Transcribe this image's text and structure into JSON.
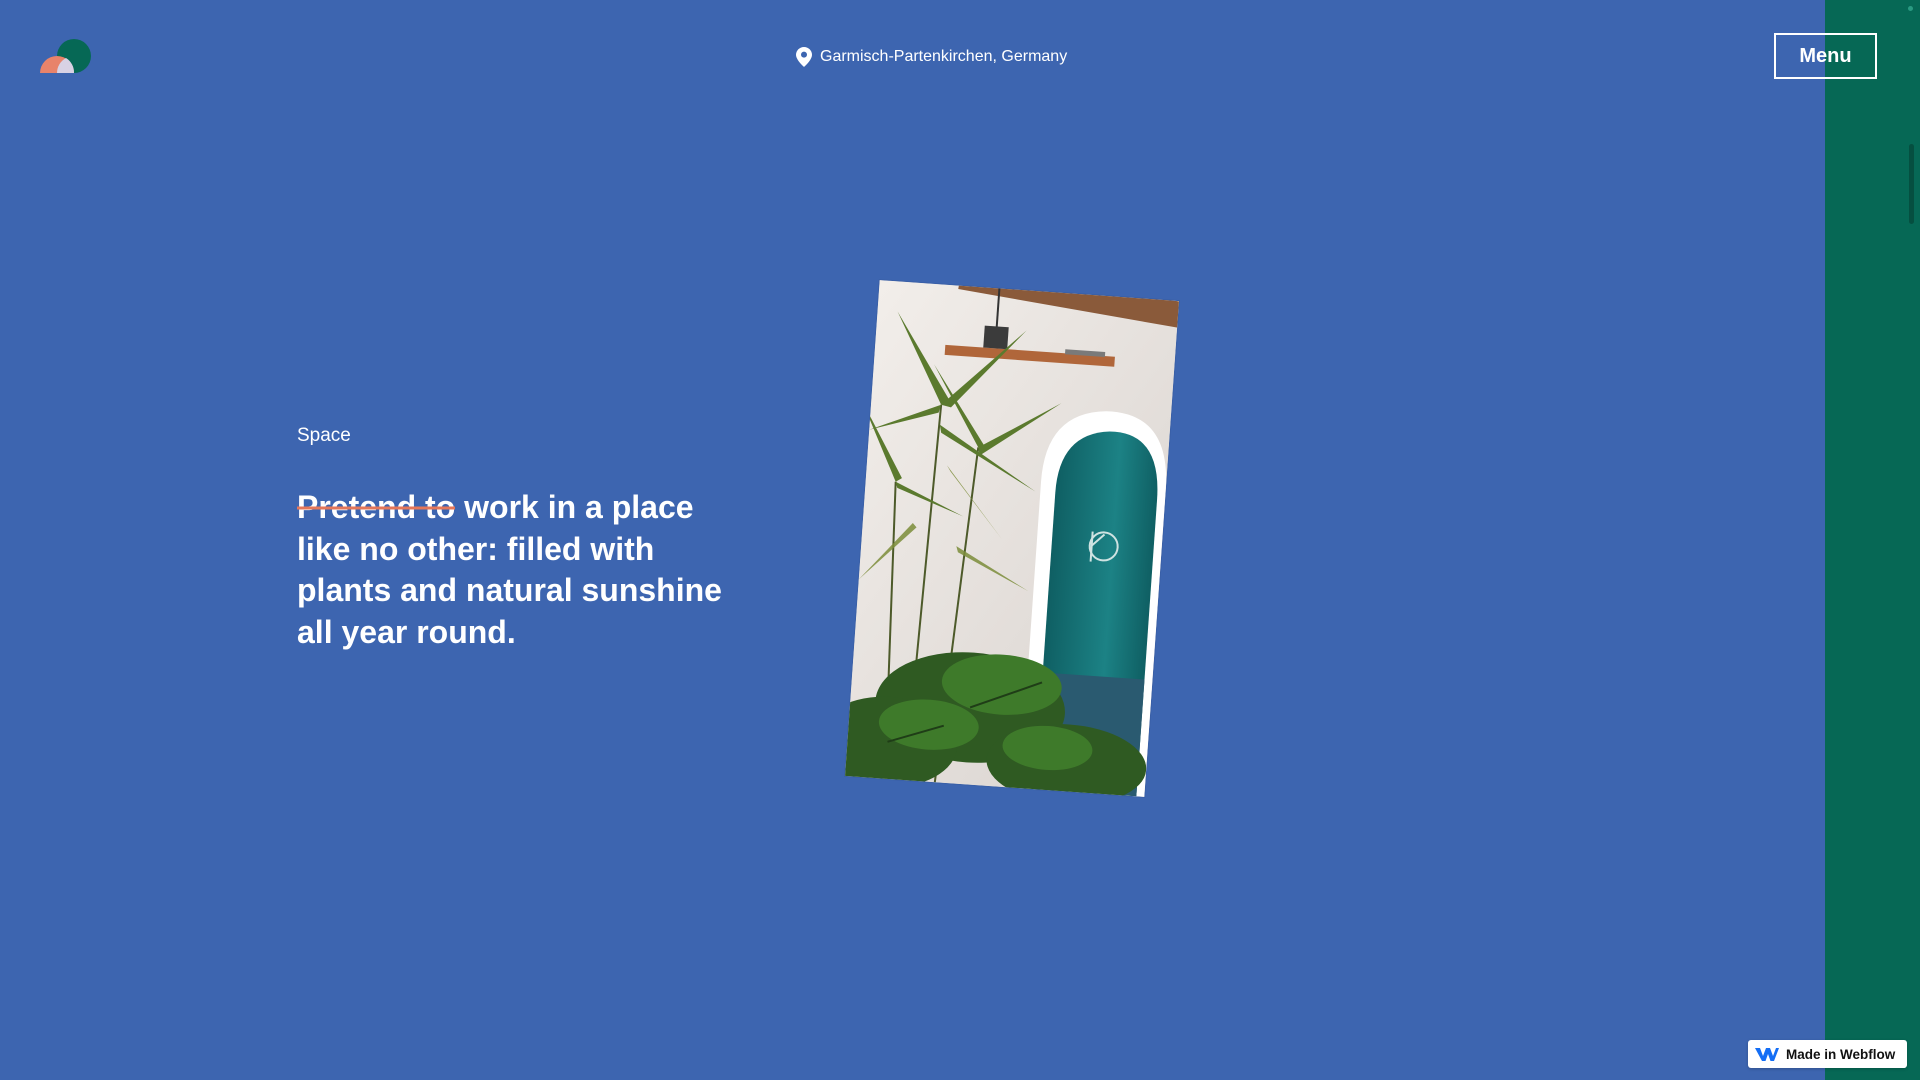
{
  "header": {
    "location": "Garmisch-Partenkirchen, Germany",
    "menu_label": "Menu"
  },
  "content": {
    "section_label": "Space",
    "headline_struck": "Pretend to",
    "headline_rest": " work in a place like no other: filled with plants and natural sunshine all year round."
  },
  "badge": {
    "label": "Made in Webflow"
  },
  "colors": {
    "background": "#3d65b0",
    "side_panel": "#066855",
    "strike_line": "#e4775a",
    "text": "#ffffff"
  },
  "icons": [
    "logo-icon",
    "location-pin-icon",
    "webflow-icon"
  ]
}
